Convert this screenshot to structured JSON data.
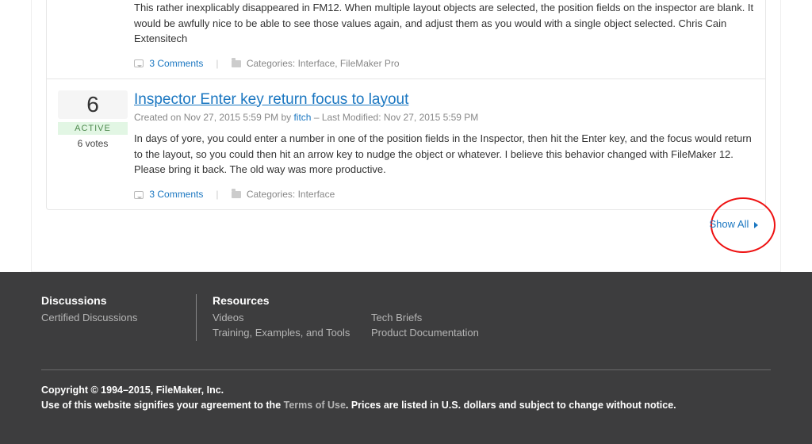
{
  "ideas": [
    {
      "body": "This rather inexplicably disappeared in FM12. When multiple layout objects are selected, the position fields on the inspector are blank. It would be awfully nice to be able to see those values again, and adjust them as you would with a single object selected.   Chris Cain Extensitech",
      "comments_label": "3 Comments",
      "categories_prefix": "Categories:",
      "categories": "Interface, FileMaker Pro"
    },
    {
      "score": "6",
      "status": "ACTIVE",
      "votes": "6 votes",
      "title": "Inspector Enter key return focus to layout",
      "meta_created": "Created on Nov 27, 2015 5:59 PM by",
      "author": "fitch",
      "meta_modified": "– Last Modified: Nov 27, 2015 5:59 PM",
      "body": "In days of yore, you could enter a number in one of the position fields in the Inspector, then hit the Enter key, and the focus would return to the layout, so you could then hit an arrow key to nudge the object or whatever. I believe this behavior changed with FileMaker 12. Please bring it back. The old way was more productive.",
      "comments_label": "3 Comments",
      "categories_prefix": "Categories:",
      "categories": "Interface"
    }
  ],
  "show_all": "Show All",
  "footer": {
    "discussions": {
      "heading": "Discussions",
      "items": [
        "Certified Discussions"
      ]
    },
    "resources": {
      "heading": "Resources",
      "left": [
        "Videos",
        "Training, Examples, and Tools"
      ],
      "right": [
        "Tech Briefs",
        "Product Documentation"
      ]
    },
    "copyright_line1": "Copyright © 1994–2015, FileMaker, Inc.",
    "copyright_prefix": "Use of this website signifies your agreement to the ",
    "terms": "Terms of Use",
    "copyright_suffix": ". Prices are listed in U.S. dollars and subject to change without notice."
  }
}
